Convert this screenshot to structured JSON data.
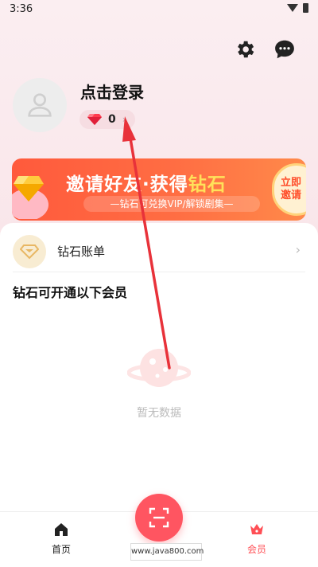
{
  "status_bar": {
    "time": "3:36"
  },
  "profile": {
    "login_label": "点击登录",
    "diamond_count": "0"
  },
  "banner": {
    "title_part1": "邀请好友·获得",
    "title_highlight": "钻石",
    "subtitle": "—钻石可兑换VIP/解锁剧集—",
    "cta_line1": "立即",
    "cta_line2": "邀请"
  },
  "diamond_bill": {
    "label": "钻石账单"
  },
  "section": {
    "title": "钻石可开通以下会员"
  },
  "empty_state": {
    "text": "暂无数据"
  },
  "bottom_nav": {
    "home_label": "首页",
    "vip_label": "会员"
  },
  "watermark": {
    "text": "www.java800.com"
  },
  "colors": {
    "accent": "#ff5561",
    "banner_start": "#ff5a3c",
    "annotation_arrow": "#e8323a"
  },
  "icons": [
    "gear-icon",
    "chat-bubble-icon",
    "user-icon",
    "diamond-icon",
    "gift-icon",
    "diamond-bill-icon",
    "chevron-right-icon",
    "planet-icon",
    "home-icon",
    "scan-icon",
    "crown-icon"
  ]
}
